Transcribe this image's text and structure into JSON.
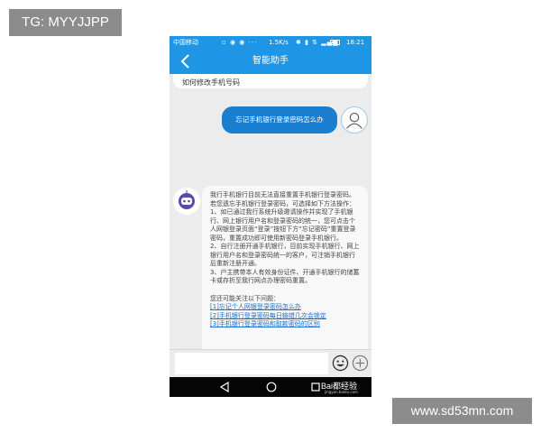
{
  "watermarks": {
    "top_left": "TG: MYYJJPP",
    "bottom_right": "www.sd53mn.com"
  },
  "status_bar": {
    "carrier": "中国移动",
    "speed": "1.5K/s",
    "time": "18:21",
    "battery_level": 0.6
  },
  "header": {
    "title": "智能助手",
    "back_icon": "chevron-left-icon",
    "color": "#1e96e5"
  },
  "chat": {
    "prev_bot_message": "如何修改手机号码",
    "user_message": "忘记手机银行登录密码怎么办",
    "bot_reply": {
      "paragraphs": [
        "我行手机银行目前无法直接重置手机银行登录密码。若您遗忘手机银行登录密码，可选择如下方法操作：",
        "1、如已通过我行系统升级邀请操作并实现了手机银行、网上银行用户名和登录密码的统一，您可点击个人网银登录页面“登录”按钮下方“忘记密码”重置登录密码，重置成功即可使用新密码登录手机银行。",
        "2、自行注册开通手机银行，目前实现手机银行、网上银行用户名和登录密码统一的客户，可注销手机银行后重新注册开通。",
        "3、户主携带本人有效身份证件、开通手机银行的储蓄卡或存折至我行网点办理密码重置。"
      ],
      "related_title": "您还可能关注以下问题：",
      "related_links": [
        "[1]忘记个人网银登录密码怎么办",
        "[2]手机银行登录密码每日输错几次会锁定",
        "[3]手机银行登录密码和取款密码的区别"
      ]
    },
    "user_bubble_color": "#1a7fd0",
    "link_color": "#1a6fd0"
  },
  "input": {
    "value": "",
    "placeholder": "",
    "emoji_icon": "smiley-icon",
    "plus_icon": "plus-icon"
  },
  "bottom_nav": {
    "icons": [
      "back-triangle-icon",
      "home-circle-icon",
      "recent-square-icon"
    ],
    "baidu_logo": "Bai都经验",
    "baidu_url": "jingyan.baidu.com"
  }
}
